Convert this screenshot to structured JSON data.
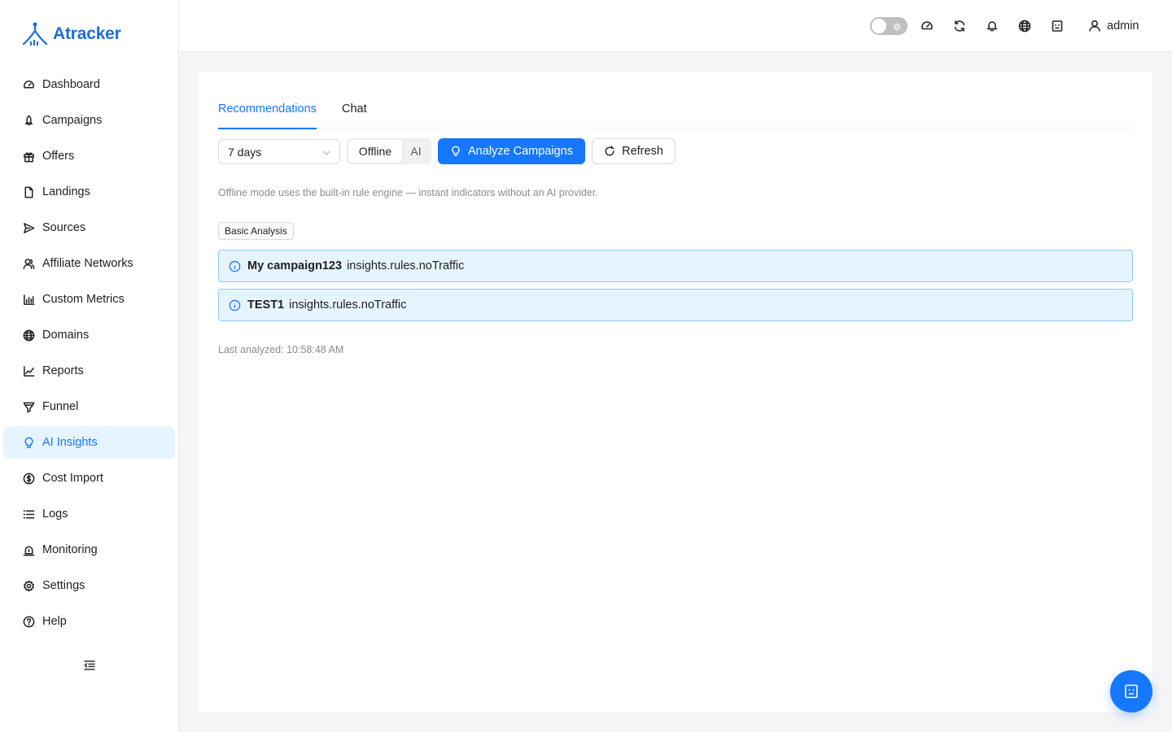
{
  "brand": {
    "name": "Atracker",
    "color": "#1a6fd8"
  },
  "sidebar": {
    "items": [
      {
        "label": "Dashboard",
        "icon": "dashboard-icon"
      },
      {
        "label": "Campaigns",
        "icon": "rocket-icon"
      },
      {
        "label": "Offers",
        "icon": "gift-icon"
      },
      {
        "label": "Landings",
        "icon": "file-icon"
      },
      {
        "label": "Sources",
        "icon": "send-icon"
      },
      {
        "label": "Affiliate Networks",
        "icon": "users-icon"
      },
      {
        "label": "Custom Metrics",
        "icon": "bar-chart-icon"
      },
      {
        "label": "Domains",
        "icon": "globe-icon"
      },
      {
        "label": "Reports",
        "icon": "line-chart-icon"
      },
      {
        "label": "Funnel",
        "icon": "funnel-icon"
      },
      {
        "label": "AI Insights",
        "icon": "bulb-icon",
        "active": true
      },
      {
        "label": "Cost Import",
        "icon": "dollar-icon"
      },
      {
        "label": "Logs",
        "icon": "list-icon"
      },
      {
        "label": "Monitoring",
        "icon": "alarm-icon"
      },
      {
        "label": "Settings",
        "icon": "gear-icon"
      },
      {
        "label": "Help",
        "icon": "question-icon"
      }
    ],
    "collapse_icon": "menu-fold-icon"
  },
  "header": {
    "theme_toggle": {
      "on": false,
      "icon": "sun-icon"
    },
    "icons": [
      "dashboard-icon",
      "sync-icon",
      "bell-icon",
      "globe-icon",
      "robot-icon"
    ],
    "user": {
      "name": "admin",
      "icon": "user-icon"
    }
  },
  "main": {
    "tabs": [
      {
        "label": "Recommendations",
        "active": true
      },
      {
        "label": "Chat",
        "active": false
      }
    ],
    "period_select": {
      "value": "7 days"
    },
    "mode": {
      "options": [
        "Offline",
        "AI"
      ],
      "selected": "Offline"
    },
    "analyze_button": "Analyze Campaigns",
    "refresh_button": "Refresh",
    "hint": "Offline mode uses the built-in rule engine — instant indicators without an AI provider.",
    "tag": "Basic Analysis",
    "alerts": [
      {
        "title": "My campaign123",
        "message": "insights.rules.noTraffic"
      },
      {
        "title": "TEST1",
        "message": "insights.rules.noTraffic"
      }
    ],
    "last_analyzed": "Last analyzed: 10:58:48 AM"
  },
  "colors": {
    "accent": "#1677ff",
    "active_bg": "#e6f4ff",
    "alert_border": "#91caff"
  }
}
